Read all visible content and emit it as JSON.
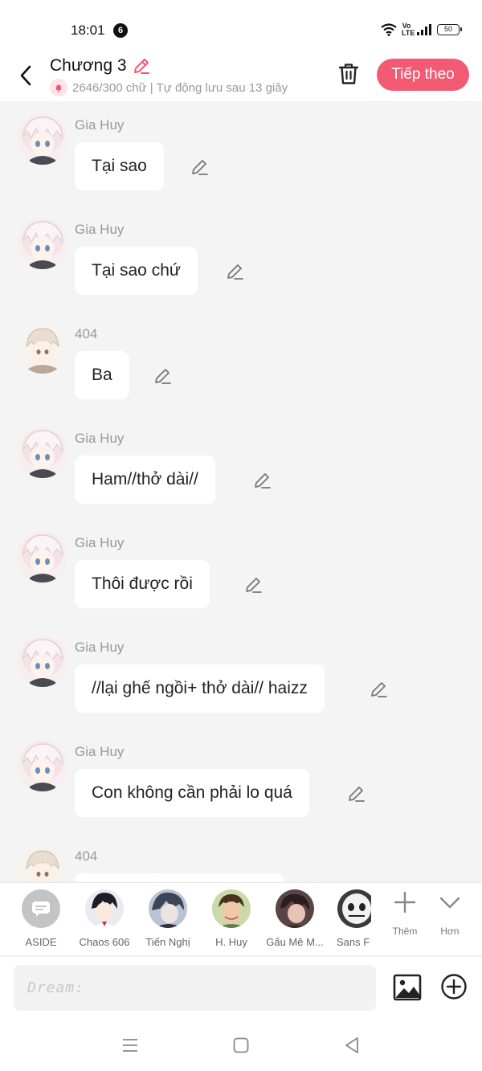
{
  "status_bar": {
    "time": "18:01",
    "notification_count": "6",
    "network_label": "Vo LTE",
    "battery": "50"
  },
  "header": {
    "chapter_title": "Chương 3",
    "counter_text": "2646/300 chữ | Tự động lưu sau 13 giây",
    "next_label": "Tiếp theo",
    "accent_color": "#f25a74"
  },
  "messages": [
    {
      "sender": "Gia Huy",
      "text": "Tại sao",
      "avatar": "gia-huy"
    },
    {
      "sender": "Gia Huy",
      "text": "Tại sao chứ",
      "avatar": "gia-huy"
    },
    {
      "sender": "404",
      "text": "Ba",
      "avatar": "404"
    },
    {
      "sender": "Gia Huy",
      "text": "Ham//thở dài//",
      "avatar": "gia-huy"
    },
    {
      "sender": "Gia Huy",
      "text": "Thôi được rồi",
      "avatar": "gia-huy"
    },
    {
      "sender": "Gia Huy",
      "text": "//lại ghế ngồi+ thở dài// haizz",
      "avatar": "gia-huy"
    },
    {
      "sender": "Gia Huy",
      "text": "Con không cần phải lo quá",
      "avatar": "gia-huy"
    },
    {
      "sender": "404",
      "text": "",
      "avatar": "404"
    }
  ],
  "characters": [
    {
      "name": "ASIDE"
    },
    {
      "name": "Chaos 606"
    },
    {
      "name": "Tiến Nghị"
    },
    {
      "name": "H. Huy"
    },
    {
      "name": "Gấu Mê M..."
    },
    {
      "name": "Sans F"
    }
  ],
  "character_actions": {
    "more_label": "Thêm",
    "expand_label": "Hơn"
  },
  "composer": {
    "placeholder": "Dream:"
  }
}
